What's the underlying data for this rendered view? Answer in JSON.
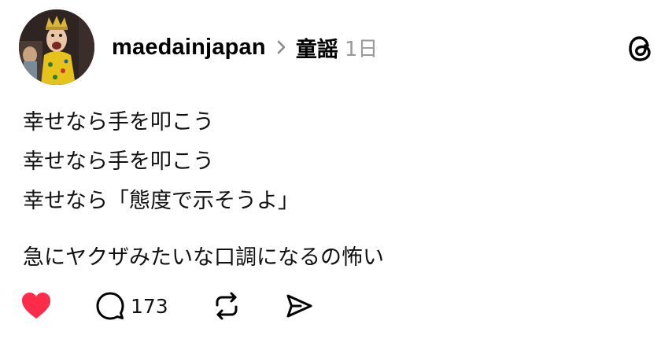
{
  "post": {
    "username": "maedainjapan",
    "topic": "童謡",
    "time": "1日",
    "lines": [
      "幸せなら手を叩こう",
      "幸せなら手を叩こう",
      "幸せなら「態度で示そうよ」",
      "急にヤクザみたいな口調になるの怖い"
    ],
    "reply_count": "173"
  },
  "icons": {
    "avatar": "avatar-image",
    "chevron": "chevron-right-icon",
    "logo": "threads-logo-icon",
    "like": "heart-icon",
    "comment": "comment-icon",
    "repost": "repost-icon",
    "share": "share-icon"
  },
  "colors": {
    "like": "#ff2b4a",
    "muted": "#9a9a9a",
    "text": "#111111"
  }
}
